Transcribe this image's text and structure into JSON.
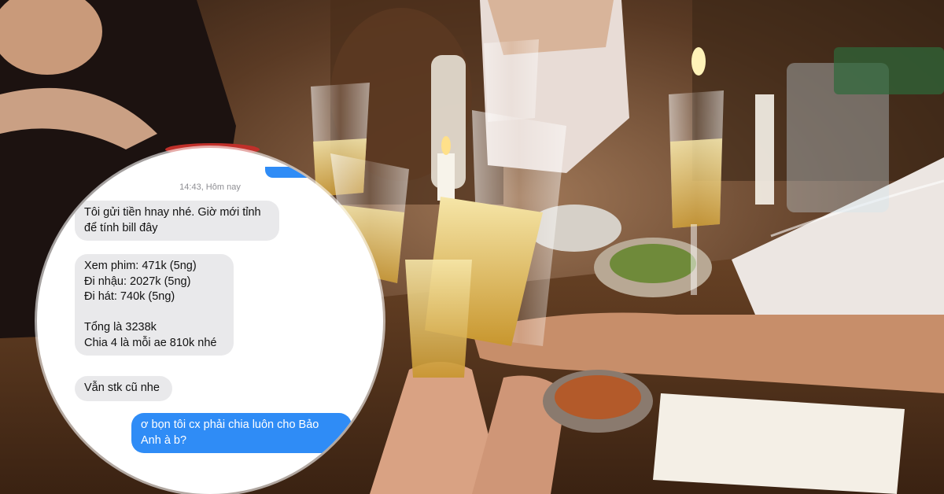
{
  "chat": {
    "timestamp": "14:43, Hôm nay",
    "messages": [
      {
        "type": "received",
        "text": "Tôi gửi tiền hnay nhé. Giờ mới tỉnh\nđể tính bill đây"
      },
      {
        "type": "received",
        "text": "Xem phim: 471k (5ng)\nĐi nhậu: 2027k (5ng)\nĐi hát: 740k (5ng)\n\nTổng là 3238k\nChia 4 là mỗi ae 810k nhé"
      },
      {
        "type": "received",
        "text": "Vẫn stk cũ nhe"
      },
      {
        "type": "sent",
        "text": "ơ bọn tôi cx phải chia luôn cho Bảo\nAnh à b?"
      }
    ]
  },
  "colors": {
    "received_bubble": "#e9e9eb",
    "sent_bubble": "#2f8cf6",
    "background_tone": "#3a2414"
  }
}
